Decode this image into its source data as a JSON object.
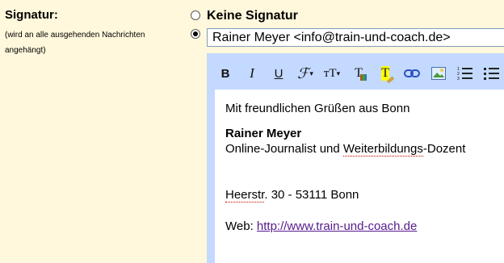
{
  "section": {
    "title": "Signatur:",
    "subtitle": "(wird an alle ausgehenden Nachrichten angehängt)"
  },
  "options": {
    "none_label": "Keine Signatur",
    "custom_selected": true,
    "sender_value": "Rainer Meyer <info@train-und-coach.de>"
  },
  "toolbar": {
    "bold": "B",
    "italic": "I",
    "underline": "U",
    "font": "ℱ",
    "size": "тT",
    "text_color": "T",
    "highlight": "T",
    "icons": [
      "bold-icon",
      "italic-icon",
      "underline-icon",
      "font-icon",
      "font-size-icon",
      "text-color-icon",
      "highlight-icon",
      "link-icon",
      "image-icon",
      "numbered-list-icon",
      "bulleted-list-icon"
    ]
  },
  "signature": {
    "greeting": "Mit freundlichen Grüßen aus Bonn",
    "name": "Rainer Meyer",
    "role_prefix": "Online-Journalist und ",
    "role_flagged": "Weiterbildungs",
    "role_suffix": "-Dozent",
    "street_flagged": "Heerstr",
    "address_rest": ". 30 - 53111 Bonn",
    "web_label": "Web: ",
    "web_url": "http://www.train-und-coach.de"
  }
}
